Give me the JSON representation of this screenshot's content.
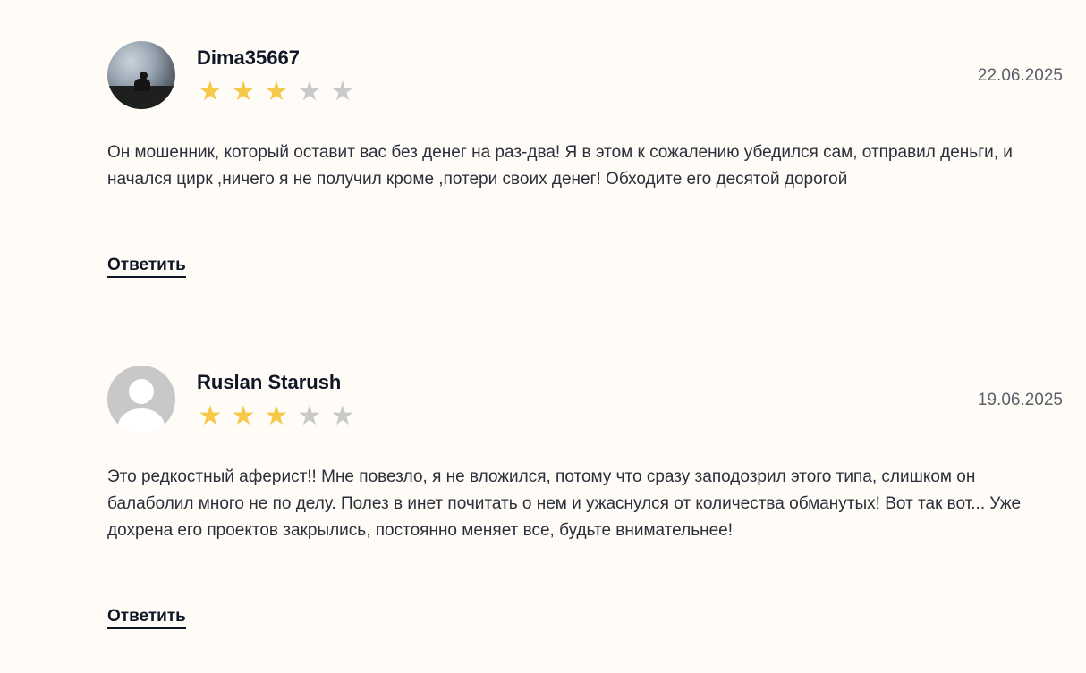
{
  "reviews": [
    {
      "author": "Dima35667",
      "avatar": "photo-avatar",
      "rating": 3,
      "rating_max": 5,
      "date": "22.06.2025",
      "text": "Он мошенник, который оставит вас без денег на раз-два! Я в этом к сожалению убедился сам, отправил деньги, и начался цирк ,ничего я не получил кроме ,потери своих денег! Обходите его десятой дорогой",
      "reply_label": "Ответить"
    },
    {
      "author": "Ruslan Starush",
      "avatar": "default-user-avatar",
      "rating": 3,
      "rating_max": 5,
      "date": "19.06.2025",
      "text": "Это редкостный аферист!! Мне повезло, я не вложился, потому что сразу заподозрил этого типа, слишком он балаболил много не по делу. Полез в инет почитать о нем и ужаснулся от количества обманутых! Вот так вот... Уже дохрена его проектов закрылись, постоянно меняет все, будьте внимательнее!",
      "reply_label": "Ответить"
    }
  ],
  "colors": {
    "background": "#fffbf7",
    "star_filled": "#f7c948",
    "star_empty": "#c9c9c9",
    "text_primary": "#0f1626"
  }
}
